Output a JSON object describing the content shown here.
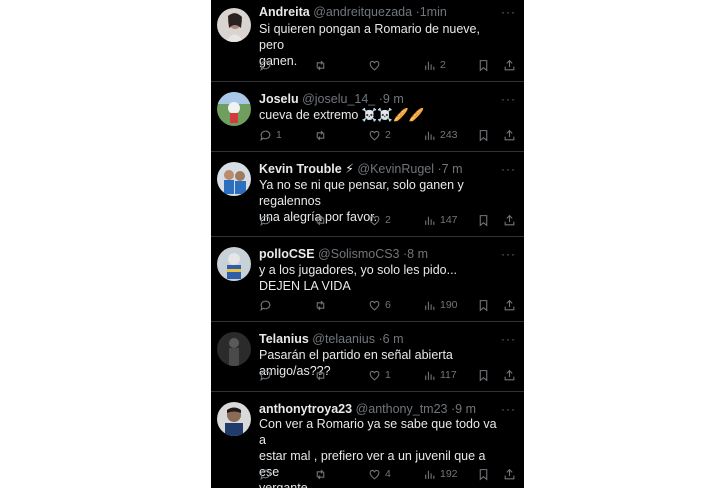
{
  "tweets": [
    {
      "name": "Andreita",
      "handle": "@andreitquezada",
      "sep": "·",
      "time": "1min",
      "text_lines": [
        "Si quieren pongan a Romario de nueve, pero",
        "ganen."
      ],
      "counts": {
        "reply": "",
        "retweet": "",
        "like": "",
        "views": "2"
      },
      "avatar_color": "#c9c2bd"
    },
    {
      "name": "Joselu",
      "handle": "@joselu_14_",
      "sep": "·",
      "time": "9 m",
      "text_lines": [
        "cueva de extremo ☠️☠️🥖🥖"
      ],
      "counts": {
        "reply": "1",
        "retweet": "",
        "like": "2",
        "views": "243"
      },
      "avatar_color": "#7ba46a"
    },
    {
      "name": "Kevin Trouble ⚡",
      "handle": "@KevinRugel",
      "sep": "·",
      "time": "7 m",
      "text_lines": [
        "Ya no se ni que pensar, solo ganen y regalennos",
        "una alegría por favor."
      ],
      "counts": {
        "reply": "",
        "retweet": "",
        "like": "2",
        "views": "147"
      },
      "avatar_color": "#5c7fa8"
    },
    {
      "name": "polloCSE",
      "handle": "@SolismoCS3",
      "sep": "·",
      "time": "8 m",
      "text_lines": [
        "y a los jugadores, yo solo les pido...",
        "DEJEN LA VIDA"
      ],
      "counts": {
        "reply": "",
        "retweet": "",
        "like": "6",
        "views": "190"
      },
      "avatar_color": "#9aa9b8"
    },
    {
      "name": "Telanius",
      "handle": "@telaanius",
      "sep": "·",
      "time": "6 m",
      "text_lines": [
        "Pasarán el partido en señal abierta amigo/as???"
      ],
      "counts": {
        "reply": "",
        "retweet": "",
        "like": "1",
        "views": "117"
      },
      "avatar_color": "#3b3b3b"
    },
    {
      "name": "anthonytroya23",
      "handle": "@anthony_tm23",
      "sep": "·",
      "time": "9 m",
      "text_lines": [
        "Con ver a Romario ya se sabe que todo va a",
        "estar mal , prefiero ver a un juvenil que a ese",
        "vergante"
      ],
      "counts": {
        "reply": "",
        "retweet": "",
        "like": "4",
        "views": "192"
      },
      "avatar_color": "#8a6b55"
    }
  ],
  "more_label": "···",
  "icons": [
    "reply-icon",
    "retweet-icon",
    "like-icon",
    "views-icon",
    "bookmark-icon",
    "share-icon",
    "more-icon"
  ],
  "colors": {
    "background": "#000000",
    "text": "#e7e9ea",
    "muted": "#71767b",
    "divider": "#2f3336"
  }
}
